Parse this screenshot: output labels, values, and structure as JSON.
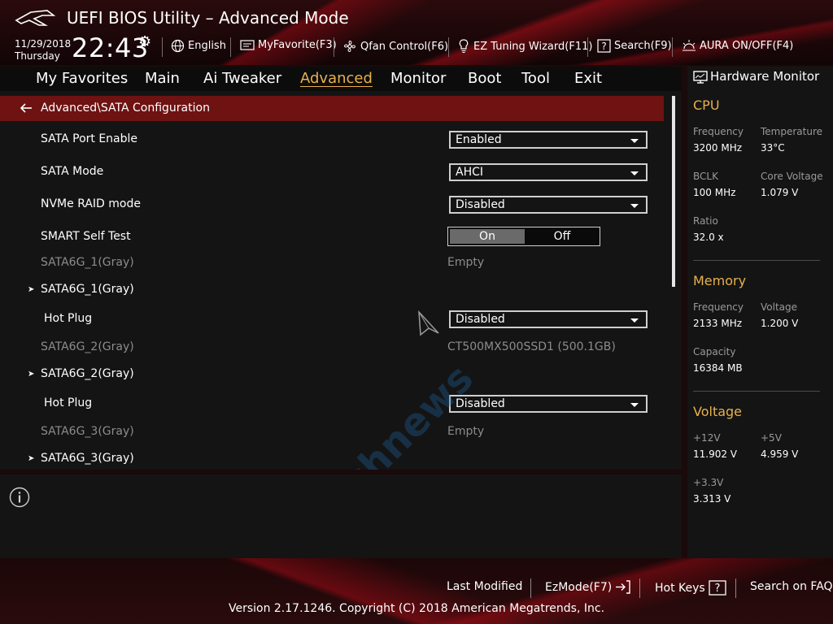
{
  "header": {
    "title": "UEFI BIOS Utility – Advanced Mode",
    "date": "11/29/2018",
    "day": "Thursday",
    "time": "22:43",
    "toolbar": [
      {
        "label": "English",
        "icon": "globe-icon"
      },
      {
        "label": "MyFavorite(F3)",
        "icon": "favorite-icon"
      },
      {
        "label": "Qfan Control(F6)",
        "icon": "fan-icon"
      },
      {
        "label": "EZ Tuning Wizard(F11)",
        "icon": "lightbulb-icon"
      },
      {
        "label": "Search(F9)",
        "icon": "search-icon"
      },
      {
        "label": "AURA ON/OFF(F4)",
        "icon": "aura-icon"
      }
    ]
  },
  "nav": {
    "items": [
      {
        "label": "My Favorites"
      },
      {
        "label": "Main"
      },
      {
        "label": "Ai Tweaker"
      },
      {
        "label": "Advanced",
        "active": true
      },
      {
        "label": "Monitor"
      },
      {
        "label": "Boot"
      },
      {
        "label": "Tool"
      },
      {
        "label": "Exit"
      }
    ]
  },
  "main": {
    "breadcrumb": "Advanced\\SATA Configuration",
    "settings": {
      "sata_port_enable": {
        "label": "SATA Port Enable",
        "value": "Enabled"
      },
      "sata_mode": {
        "label": "SATA Mode",
        "value": "AHCI"
      },
      "nvme_raid": {
        "label": "NVMe RAID mode",
        "value": "Disabled"
      },
      "smart_self_test": {
        "label": "SMART Self Test",
        "on": "On",
        "off": "Off",
        "selected": "On"
      },
      "port1_info": {
        "label": "SATA6G_1(Gray)",
        "value": "Empty"
      },
      "port1_sub": {
        "label": "SATA6G_1(Gray)"
      },
      "port1_hotplug": {
        "label": "Hot Plug",
        "value": "Disabled"
      },
      "port2_info": {
        "label": "SATA6G_2(Gray)",
        "value": "CT500MX500SSD1 (500.1GB)"
      },
      "port2_sub": {
        "label": "SATA6G_2(Gray)"
      },
      "port2_hotplug": {
        "label": "Hot Plug",
        "value": "Disabled"
      },
      "port3_info": {
        "label": "SATA6G_3(Gray)",
        "value": "Empty"
      },
      "port3_sub": {
        "label": "SATA6G_3(Gray)"
      }
    }
  },
  "hardware_monitor": {
    "title": "Hardware Monitor",
    "cpu": {
      "heading": "CPU",
      "frequency_label": "Frequency",
      "frequency": "3200 MHz",
      "temperature_label": "Temperature",
      "temperature": "33°C",
      "bclk_label": "BCLK",
      "bclk": "100 MHz",
      "core_voltage_label": "Core Voltage",
      "core_voltage": "1.079 V",
      "ratio_label": "Ratio",
      "ratio": "32.0 x"
    },
    "memory": {
      "heading": "Memory",
      "frequency_label": "Frequency",
      "frequency": "2133 MHz",
      "voltage_label": "Voltage",
      "voltage": "1.200 V",
      "capacity_label": "Capacity",
      "capacity": "16384 MB"
    },
    "voltage": {
      "heading": "Voltage",
      "v12_label": "+12V",
      "v12": "11.902 V",
      "v5_label": "+5V",
      "v5": "4.959 V",
      "v33_label": "+3.3V",
      "v33": "3.313 V"
    }
  },
  "footer": {
    "last_modified": "Last Modified",
    "ezmode": "EzMode(F7)",
    "hot_keys": "Hot Keys",
    "search_faq": "Search on FAQ",
    "copyright": "Version 2.17.1246. Copyright (C) 2018 American Megatrends, Inc."
  },
  "watermark": {
    "text": "Technews"
  },
  "colors": {
    "accent": "#e8b04c",
    "breadcrumb_bg": "#6f1212",
    "panel_bg": "#141414"
  }
}
